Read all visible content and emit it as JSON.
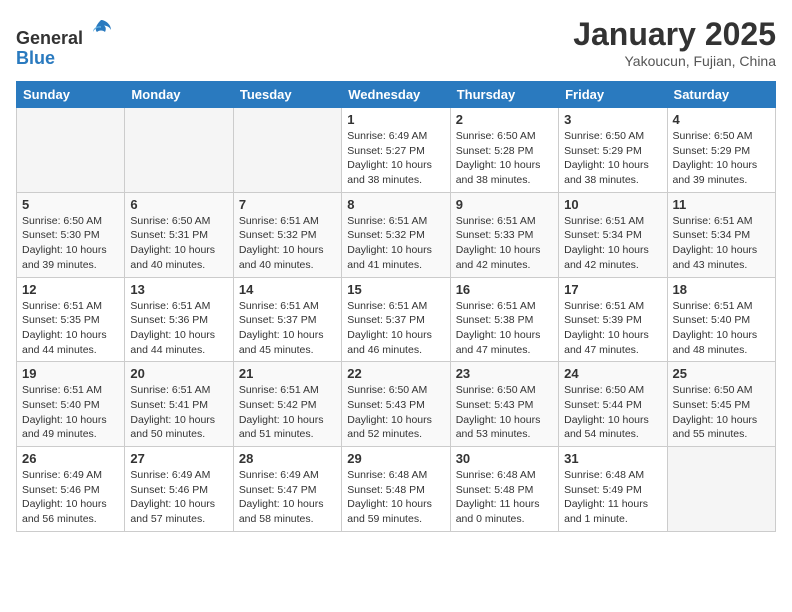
{
  "header": {
    "logo_line1": "General",
    "logo_line2": "Blue",
    "month": "January 2025",
    "location": "Yakoucun, Fujian, China"
  },
  "weekdays": [
    "Sunday",
    "Monday",
    "Tuesday",
    "Wednesday",
    "Thursday",
    "Friday",
    "Saturday"
  ],
  "weeks": [
    [
      {
        "day": "",
        "info": ""
      },
      {
        "day": "",
        "info": ""
      },
      {
        "day": "",
        "info": ""
      },
      {
        "day": "1",
        "info": "Sunrise: 6:49 AM\nSunset: 5:27 PM\nDaylight: 10 hours\nand 38 minutes."
      },
      {
        "day": "2",
        "info": "Sunrise: 6:50 AM\nSunset: 5:28 PM\nDaylight: 10 hours\nand 38 minutes."
      },
      {
        "day": "3",
        "info": "Sunrise: 6:50 AM\nSunset: 5:29 PM\nDaylight: 10 hours\nand 38 minutes."
      },
      {
        "day": "4",
        "info": "Sunrise: 6:50 AM\nSunset: 5:29 PM\nDaylight: 10 hours\nand 39 minutes."
      }
    ],
    [
      {
        "day": "5",
        "info": "Sunrise: 6:50 AM\nSunset: 5:30 PM\nDaylight: 10 hours\nand 39 minutes."
      },
      {
        "day": "6",
        "info": "Sunrise: 6:50 AM\nSunset: 5:31 PM\nDaylight: 10 hours\nand 40 minutes."
      },
      {
        "day": "7",
        "info": "Sunrise: 6:51 AM\nSunset: 5:32 PM\nDaylight: 10 hours\nand 40 minutes."
      },
      {
        "day": "8",
        "info": "Sunrise: 6:51 AM\nSunset: 5:32 PM\nDaylight: 10 hours\nand 41 minutes."
      },
      {
        "day": "9",
        "info": "Sunrise: 6:51 AM\nSunset: 5:33 PM\nDaylight: 10 hours\nand 42 minutes."
      },
      {
        "day": "10",
        "info": "Sunrise: 6:51 AM\nSunset: 5:34 PM\nDaylight: 10 hours\nand 42 minutes."
      },
      {
        "day": "11",
        "info": "Sunrise: 6:51 AM\nSunset: 5:34 PM\nDaylight: 10 hours\nand 43 minutes."
      }
    ],
    [
      {
        "day": "12",
        "info": "Sunrise: 6:51 AM\nSunset: 5:35 PM\nDaylight: 10 hours\nand 44 minutes."
      },
      {
        "day": "13",
        "info": "Sunrise: 6:51 AM\nSunset: 5:36 PM\nDaylight: 10 hours\nand 44 minutes."
      },
      {
        "day": "14",
        "info": "Sunrise: 6:51 AM\nSunset: 5:37 PM\nDaylight: 10 hours\nand 45 minutes."
      },
      {
        "day": "15",
        "info": "Sunrise: 6:51 AM\nSunset: 5:37 PM\nDaylight: 10 hours\nand 46 minutes."
      },
      {
        "day": "16",
        "info": "Sunrise: 6:51 AM\nSunset: 5:38 PM\nDaylight: 10 hours\nand 47 minutes."
      },
      {
        "day": "17",
        "info": "Sunrise: 6:51 AM\nSunset: 5:39 PM\nDaylight: 10 hours\nand 47 minutes."
      },
      {
        "day": "18",
        "info": "Sunrise: 6:51 AM\nSunset: 5:40 PM\nDaylight: 10 hours\nand 48 minutes."
      }
    ],
    [
      {
        "day": "19",
        "info": "Sunrise: 6:51 AM\nSunset: 5:40 PM\nDaylight: 10 hours\nand 49 minutes."
      },
      {
        "day": "20",
        "info": "Sunrise: 6:51 AM\nSunset: 5:41 PM\nDaylight: 10 hours\nand 50 minutes."
      },
      {
        "day": "21",
        "info": "Sunrise: 6:51 AM\nSunset: 5:42 PM\nDaylight: 10 hours\nand 51 minutes."
      },
      {
        "day": "22",
        "info": "Sunrise: 6:50 AM\nSunset: 5:43 PM\nDaylight: 10 hours\nand 52 minutes."
      },
      {
        "day": "23",
        "info": "Sunrise: 6:50 AM\nSunset: 5:43 PM\nDaylight: 10 hours\nand 53 minutes."
      },
      {
        "day": "24",
        "info": "Sunrise: 6:50 AM\nSunset: 5:44 PM\nDaylight: 10 hours\nand 54 minutes."
      },
      {
        "day": "25",
        "info": "Sunrise: 6:50 AM\nSunset: 5:45 PM\nDaylight: 10 hours\nand 55 minutes."
      }
    ],
    [
      {
        "day": "26",
        "info": "Sunrise: 6:49 AM\nSunset: 5:46 PM\nDaylight: 10 hours\nand 56 minutes."
      },
      {
        "day": "27",
        "info": "Sunrise: 6:49 AM\nSunset: 5:46 PM\nDaylight: 10 hours\nand 57 minutes."
      },
      {
        "day": "28",
        "info": "Sunrise: 6:49 AM\nSunset: 5:47 PM\nDaylight: 10 hours\nand 58 minutes."
      },
      {
        "day": "29",
        "info": "Sunrise: 6:48 AM\nSunset: 5:48 PM\nDaylight: 10 hours\nand 59 minutes."
      },
      {
        "day": "30",
        "info": "Sunrise: 6:48 AM\nSunset: 5:48 PM\nDaylight: 11 hours\nand 0 minutes."
      },
      {
        "day": "31",
        "info": "Sunrise: 6:48 AM\nSunset: 5:49 PM\nDaylight: 11 hours\nand 1 minute."
      },
      {
        "day": "",
        "info": ""
      }
    ]
  ]
}
